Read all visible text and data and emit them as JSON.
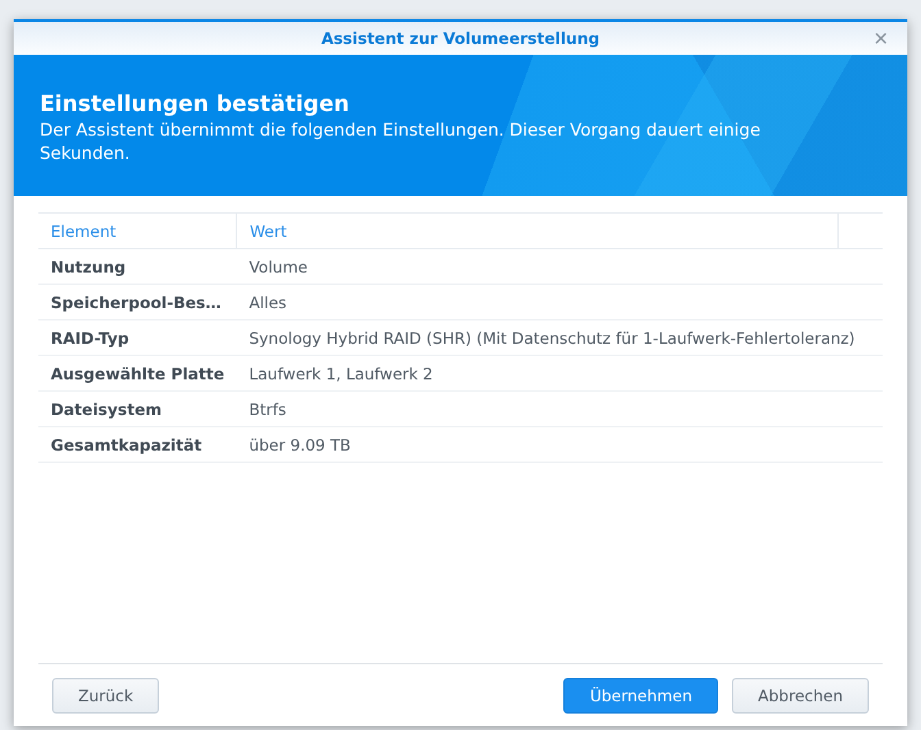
{
  "dialog": {
    "title": "Assistent zur Volumeerstellung",
    "close": "×"
  },
  "banner": {
    "heading": "Einstellungen bestätigen",
    "description": "Der Assistent übernimmt die folgenden Einstellungen. Dieser Vorgang dauert einige Sekunden."
  },
  "table": {
    "columns": [
      "Element",
      "Wert"
    ],
    "rows": [
      {
        "element": "Nutzung",
        "value": "Volume"
      },
      {
        "element": "Speicherpool-Bes…",
        "value": "Alles"
      },
      {
        "element": "RAID-Typ",
        "value": "Synology Hybrid RAID (SHR) (Mit Datenschutz für 1-Laufwerk-Fehlertoleranz)"
      },
      {
        "element": "Ausgewählte Platte",
        "value": "Laufwerk 1, Laufwerk 2"
      },
      {
        "element": "Dateisystem",
        "value": "Btrfs"
      },
      {
        "element": "Gesamtkapazität",
        "value": "über 9.09 TB"
      }
    ]
  },
  "buttons": [
    {
      "label": "Zurück",
      "kind": "secondary"
    },
    {
      "label": "Übernehmen",
      "kind": "primary"
    },
    {
      "label": "Abbrechen",
      "kind": "secondary"
    }
  ]
}
